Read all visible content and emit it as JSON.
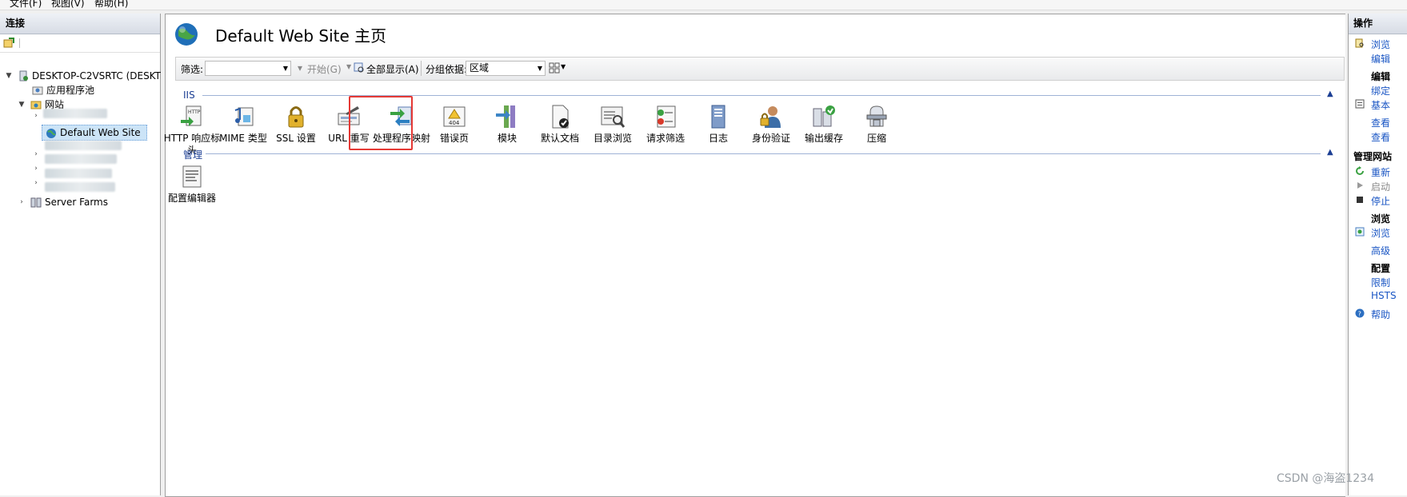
{
  "menubar": {
    "file": "文件(F)",
    "view": "视图(V)",
    "help": "帮助(H)"
  },
  "connections": {
    "title": "连接",
    "tree": {
      "server": "DESKTOP-C2VSRTC (DESKT",
      "app_pools": "应用程序池",
      "sites": "网站",
      "default_site": "Default Web Site",
      "server_farms": "Server Farms"
    }
  },
  "main": {
    "title": "Default Web Site 主页",
    "filter": {
      "label": "筛选:",
      "value": "",
      "go": "开始(G)",
      "show_all": "全部显示(A)",
      "group_label": "分组依据:",
      "group_value": "区域"
    },
    "groups": [
      {
        "name": "IIS",
        "features": [
          {
            "label": "HTTP 响应标头",
            "icon": "http-response-headers-icon"
          },
          {
            "label": "MIME 类型",
            "icon": "mime-types-icon"
          },
          {
            "label": "SSL 设置",
            "icon": "ssl-lock-icon"
          },
          {
            "label": "URL 重写",
            "icon": "url-rewrite-icon"
          },
          {
            "label": "处理程序映射",
            "icon": "handler-mappings-icon"
          },
          {
            "label": "错误页",
            "icon": "error-pages-icon"
          },
          {
            "label": "模块",
            "icon": "modules-icon"
          },
          {
            "label": "默认文档",
            "icon": "default-document-icon"
          },
          {
            "label": "目录浏览",
            "icon": "directory-browsing-icon"
          },
          {
            "label": "请求筛选",
            "icon": "request-filtering-icon"
          },
          {
            "label": "日志",
            "icon": "logging-icon"
          },
          {
            "label": "身份验证",
            "icon": "authentication-icon"
          },
          {
            "label": "输出缓存",
            "icon": "output-caching-icon"
          },
          {
            "label": "压缩",
            "icon": "compression-icon"
          }
        ]
      },
      {
        "name": "管理",
        "features": [
          {
            "label": "配置编辑器",
            "icon": "configuration-editor-icon"
          }
        ]
      }
    ]
  },
  "actions": {
    "title": "操作",
    "items": [
      {
        "label": "浏览",
        "kind": "link"
      },
      {
        "label": "编辑",
        "kind": "link"
      },
      {
        "label": "编辑",
        "kind": "bold"
      },
      {
        "label": "绑定",
        "kind": "link"
      },
      {
        "label": "基本",
        "kind": "link"
      },
      {
        "label": "查看",
        "kind": "link"
      },
      {
        "label": "查看",
        "kind": "link"
      },
      {
        "label": "管理网站",
        "kind": "section"
      },
      {
        "label": "重新",
        "kind": "link"
      },
      {
        "label": "启动",
        "kind": "disabled"
      },
      {
        "label": "停止",
        "kind": "link"
      },
      {
        "label": "浏览",
        "kind": "bold"
      },
      {
        "label": "浏览",
        "kind": "link"
      },
      {
        "label": "高级",
        "kind": "link"
      },
      {
        "label": "配置",
        "kind": "bold"
      },
      {
        "label": "限制",
        "kind": "link"
      },
      {
        "label": "HSTS",
        "kind": "link"
      },
      {
        "label": "帮助",
        "kind": "link"
      }
    ]
  },
  "watermark": "CSDN @海盗1234",
  "colors": {
    "accent": "#1a56c4",
    "group_header": "#1c3f94",
    "highlight": "#e53935"
  }
}
